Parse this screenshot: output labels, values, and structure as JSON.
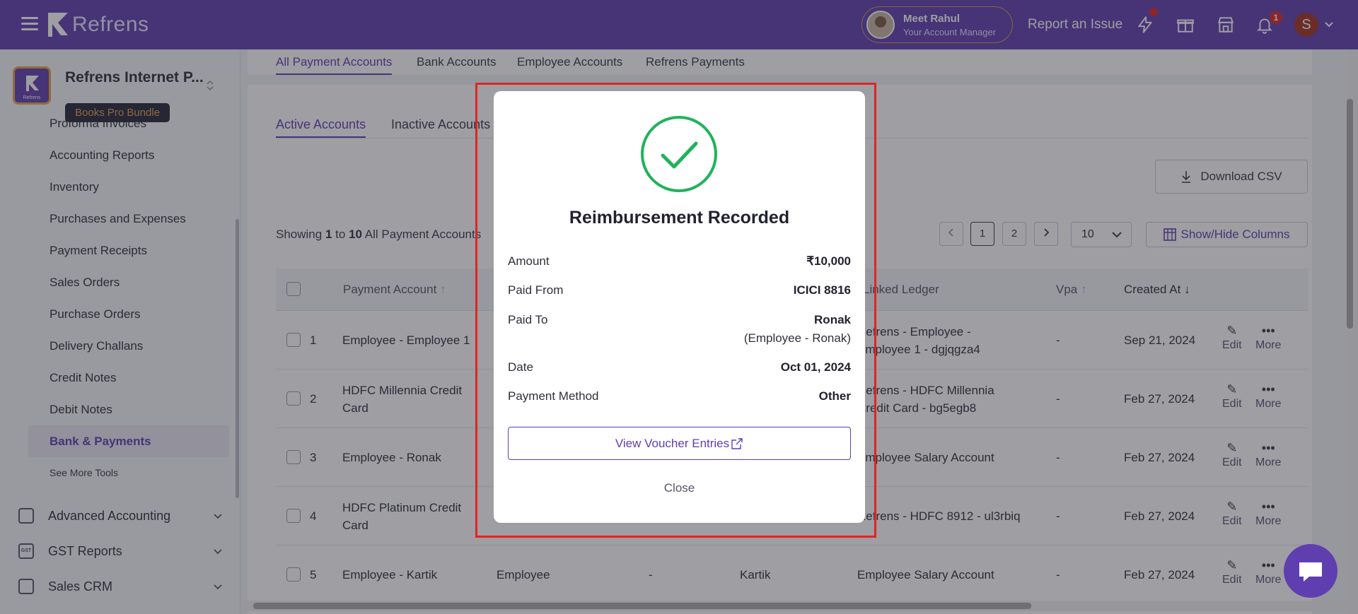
{
  "topbar": {
    "brand": "Refrens",
    "manager_name": "Meet Rahul",
    "manager_role": "Your Account Manager",
    "report_issue": "Report an Issue",
    "notification_count": "1",
    "user_initial": "S"
  },
  "sidebar": {
    "org_name": "Refrens Internet P...",
    "org_logo_text": "Refrens",
    "plan_badge": "Books Pro Bundle",
    "items": [
      {
        "label": "Proforma Invoices"
      },
      {
        "label": "Accounting Reports"
      },
      {
        "label": "Inventory"
      },
      {
        "label": "Purchases and Expenses"
      },
      {
        "label": "Payment Receipts"
      },
      {
        "label": "Sales Orders"
      },
      {
        "label": "Purchase Orders"
      },
      {
        "label": "Delivery Challans"
      },
      {
        "label": "Credit Notes"
      },
      {
        "label": "Debit Notes"
      },
      {
        "label": "Bank & Payments"
      }
    ],
    "see_more": "See More Tools",
    "sections": [
      {
        "label": "Advanced Accounting"
      },
      {
        "label": "GST Reports",
        "icon_text": "GST"
      },
      {
        "label": "Sales CRM"
      }
    ]
  },
  "main": {
    "tabs": [
      {
        "label": "All Payment Accounts"
      },
      {
        "label": "Bank Accounts"
      },
      {
        "label": "Employee Accounts"
      },
      {
        "label": "Refrens Payments"
      }
    ],
    "subtabs": [
      {
        "label": "Active Accounts"
      },
      {
        "label": "Inactive Accounts"
      }
    ],
    "download_csv": "Download CSV",
    "showing_prefix": "Showing",
    "showing_from": "1",
    "showing_to_word": "to",
    "showing_to": "10",
    "showing_suffix": "All Payment Accounts",
    "pages": [
      "1",
      "2"
    ],
    "per_page": "10",
    "show_hide_columns": "Show/Hide Columns",
    "columns": {
      "payment_account": "Payment Account",
      "linked_ledger": "Linked Ledger",
      "vpa": "Vpa",
      "created_at": "Created At"
    },
    "rows": [
      {
        "num": "1",
        "account": "Employee - Employee 1",
        "type": "",
        "dash": "",
        "name": "",
        "ledger": "Refrens - Employee - Employee 1 - dgjqgza4",
        "vpa": "-",
        "created": "Sep 21, 2024"
      },
      {
        "num": "2",
        "account": "HDFC Millennia Credit Card",
        "type": "",
        "dash": "",
        "name": "",
        "ledger": "Refrens - HDFC Millennia Credit Card - bg5egb8",
        "vpa": "-",
        "created": "Feb 27, 2024"
      },
      {
        "num": "3",
        "account": "Employee - Ronak",
        "type": "",
        "dash": "",
        "name": "",
        "ledger": "Employee Salary Account",
        "vpa": "-",
        "created": "Feb 27, 2024"
      },
      {
        "num": "4",
        "account": "HDFC Platinum Credit Card",
        "type": "",
        "dash": "",
        "name": "",
        "ledger": "Refrens - HDFC 8912 - ul3rbiq",
        "vpa": "-",
        "created": "Feb 27, 2024"
      },
      {
        "num": "5",
        "account": "Employee - Kartik",
        "type": "Employee",
        "dash": "-",
        "name": "Kartik",
        "ledger": "Employee Salary Account",
        "vpa": "-",
        "created": "Feb 27, 2024"
      }
    ],
    "edit_label": "Edit",
    "more_label": "More"
  },
  "modal": {
    "title": "Reimbursement Recorded",
    "amount_label": "Amount",
    "amount_value": "₹10,000",
    "paid_from_label": "Paid From",
    "paid_from_value": "ICICI 8816",
    "paid_to_label": "Paid To",
    "paid_to_value": "Ronak",
    "paid_to_sub": "(Employee - Ronak)",
    "date_label": "Date",
    "date_value": "Oct 01, 2024",
    "method_label": "Payment Method",
    "method_value": "Other",
    "voucher_button": "View Voucher Entries",
    "close_label": "Close"
  },
  "colors": {
    "brand": "#5f3fb0",
    "success": "#1fb35a",
    "highlight": "#e02424"
  }
}
